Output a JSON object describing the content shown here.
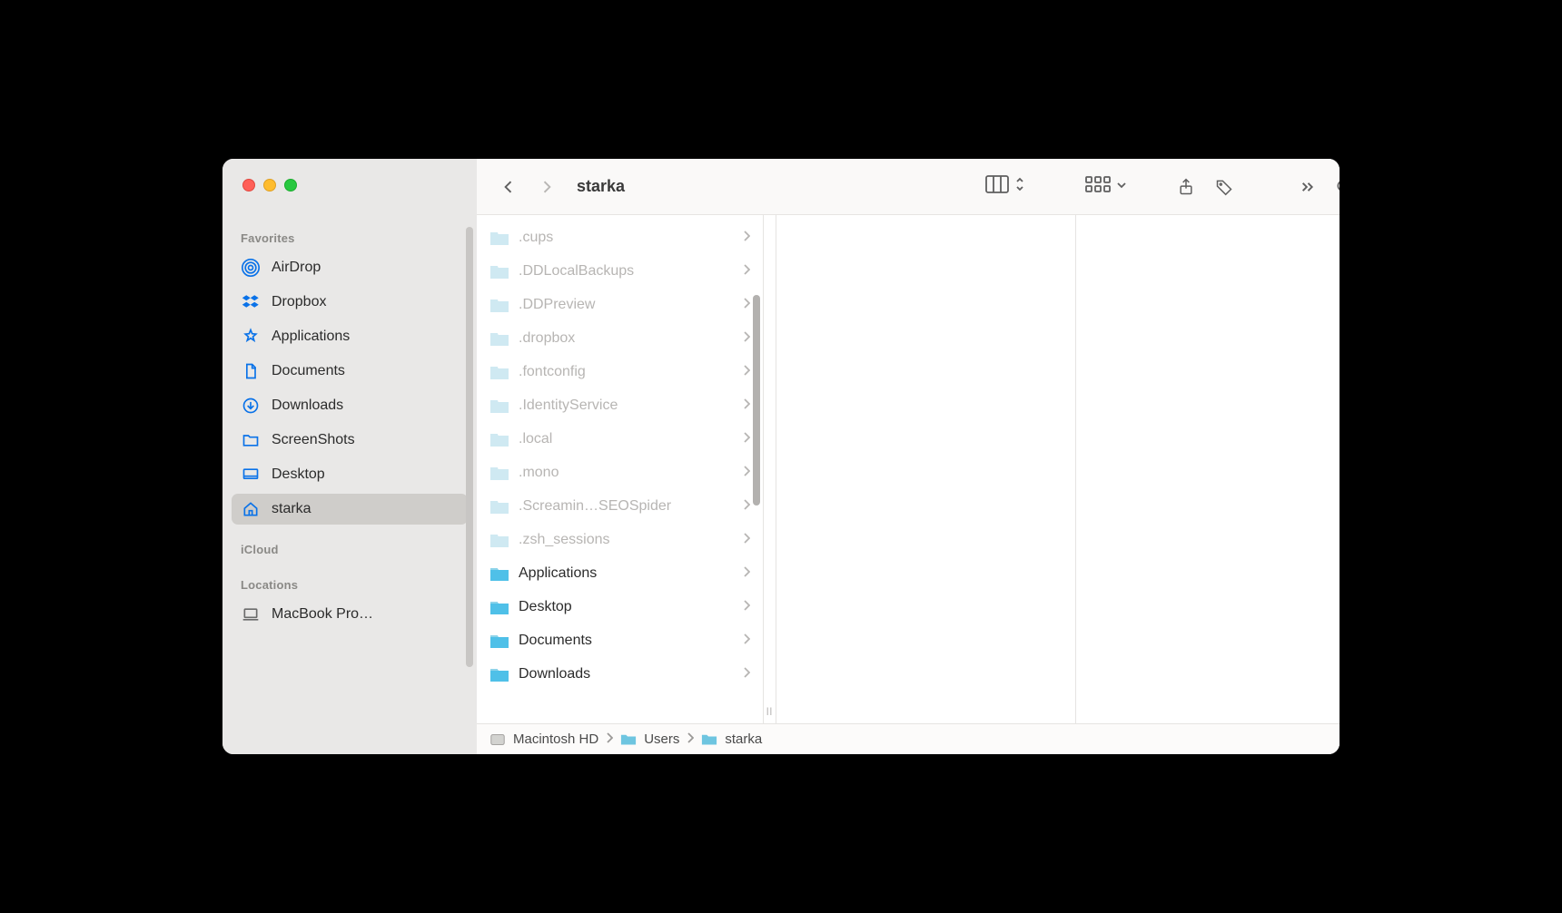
{
  "window_title": "starka",
  "sidebar": {
    "sections": [
      {
        "label": "Favorites",
        "items": [
          {
            "icon": "airdrop",
            "label": "AirDrop",
            "selected": false
          },
          {
            "icon": "dropbox",
            "label": "Dropbox",
            "selected": false
          },
          {
            "icon": "applications",
            "label": "Applications",
            "selected": false
          },
          {
            "icon": "documents",
            "label": "Documents",
            "selected": false
          },
          {
            "icon": "downloads",
            "label": "Downloads",
            "selected": false
          },
          {
            "icon": "screenshots",
            "label": "ScreenShots",
            "selected": false
          },
          {
            "icon": "desktop",
            "label": "Desktop",
            "selected": false
          },
          {
            "icon": "home",
            "label": "starka",
            "selected": true
          }
        ]
      },
      {
        "label": "iCloud",
        "items": []
      },
      {
        "label": "Locations",
        "items": [
          {
            "icon": "laptop",
            "label": "MacBook Pro…",
            "selected": false
          }
        ]
      }
    ]
  },
  "column": {
    "items": [
      {
        "name": ".cups",
        "hidden": true
      },
      {
        "name": ".DDLocalBackups",
        "hidden": true
      },
      {
        "name": ".DDPreview",
        "hidden": true
      },
      {
        "name": ".dropbox",
        "hidden": true
      },
      {
        "name": ".fontconfig",
        "hidden": true
      },
      {
        "name": ".IdentityService",
        "hidden": true
      },
      {
        "name": ".local",
        "hidden": true
      },
      {
        "name": ".mono",
        "hidden": true
      },
      {
        "name": ".Screamin…SEOSpider",
        "hidden": true
      },
      {
        "name": ".zsh_sessions",
        "hidden": true
      },
      {
        "name": "Applications",
        "hidden": false
      },
      {
        "name": "Desktop",
        "hidden": false
      },
      {
        "name": "Documents",
        "hidden": false
      },
      {
        "name": "Downloads",
        "hidden": false
      }
    ]
  },
  "path": [
    {
      "icon": "hdd",
      "label": "Macintosh HD"
    },
    {
      "icon": "folder",
      "label": "Users"
    },
    {
      "icon": "home",
      "label": "starka"
    }
  ]
}
